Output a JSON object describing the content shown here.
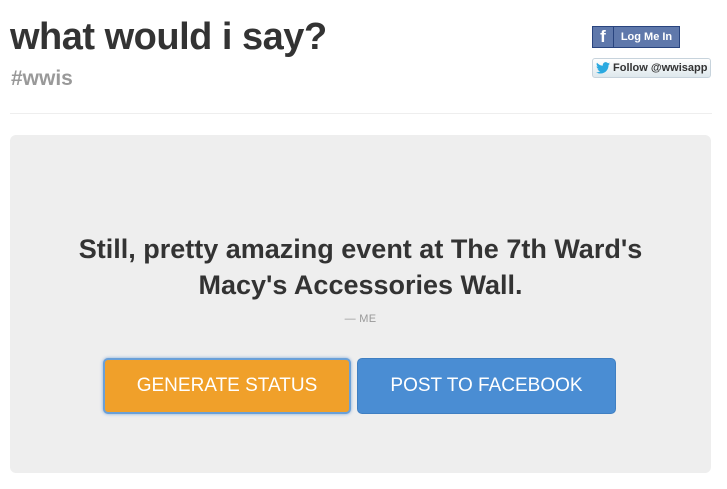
{
  "header": {
    "title": "what would i say?",
    "hashtag": "#wwis"
  },
  "social": {
    "facebook_login_label": "Log Me In",
    "facebook_icon_glyph": "f",
    "twitter_follow_label": "Follow @wwisapp"
  },
  "main": {
    "quote": "Still, pretty amazing event at The 7th Ward's Macy's Accessories Wall.",
    "attribution": "— ME",
    "generate_button_label": "GENERATE STATUS",
    "post_button_label": "POST TO FACEBOOK"
  },
  "colors": {
    "generate_button": "#f0a02a",
    "post_button": "#4a8dd3",
    "facebook_blue": "#5f78ab",
    "twitter_blue": "#2aa9e0",
    "hero_background": "#eeeeee"
  },
  "icons": {
    "facebook": "facebook-icon",
    "twitter": "twitter-bird-icon"
  }
}
